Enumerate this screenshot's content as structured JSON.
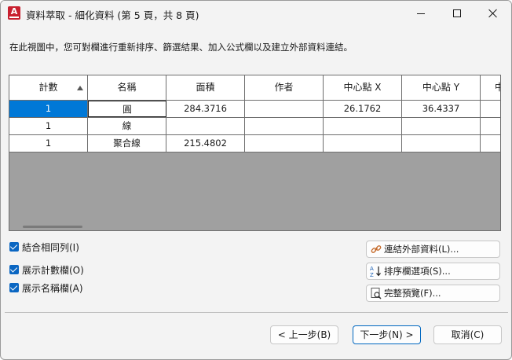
{
  "window": {
    "title": "資料萃取 - 細化資料 (第 5 頁，共 8 頁)",
    "app_icon_letter": "A"
  },
  "instruction": "在此視圖中，您可對欄進行重新排序、篩選結果、加入公式欄以及建立外部資料連結。",
  "grid": {
    "columns": [
      "計數",
      "名稱",
      "面積",
      "作者",
      "中心點 X",
      "中心點 Y",
      "中"
    ],
    "sorted_column": "計數",
    "rows": [
      [
        "1",
        "圓",
        "284.3716",
        "",
        "26.1762",
        "36.4337",
        ""
      ],
      [
        "1",
        "線",
        "",
        "",
        "",
        "",
        ""
      ],
      [
        "1",
        "聚合線",
        "215.4802",
        "",
        "",
        "",
        ""
      ]
    ]
  },
  "options": {
    "combine_rows": "結合相同列(I)",
    "show_count": "展示計數欄(O)",
    "show_name": "展示名稱欄(A)"
  },
  "side_buttons": {
    "link_external": "連結外部資料(L)...",
    "sort_columns": "排序欄選項(S)...",
    "full_preview": "完整預覽(F)..."
  },
  "nav": {
    "back": "< 上一步(B)",
    "next": "下一步(N) >",
    "cancel": "取消(C)"
  },
  "colors": {
    "accent": "#0078d7",
    "app_icon": "#c8202f",
    "grid_empty": "#a0a0a0"
  },
  "icons": [
    "minimize-icon",
    "maximize-icon",
    "close-icon",
    "link-icon",
    "sort-az-icon",
    "preview-icon"
  ]
}
